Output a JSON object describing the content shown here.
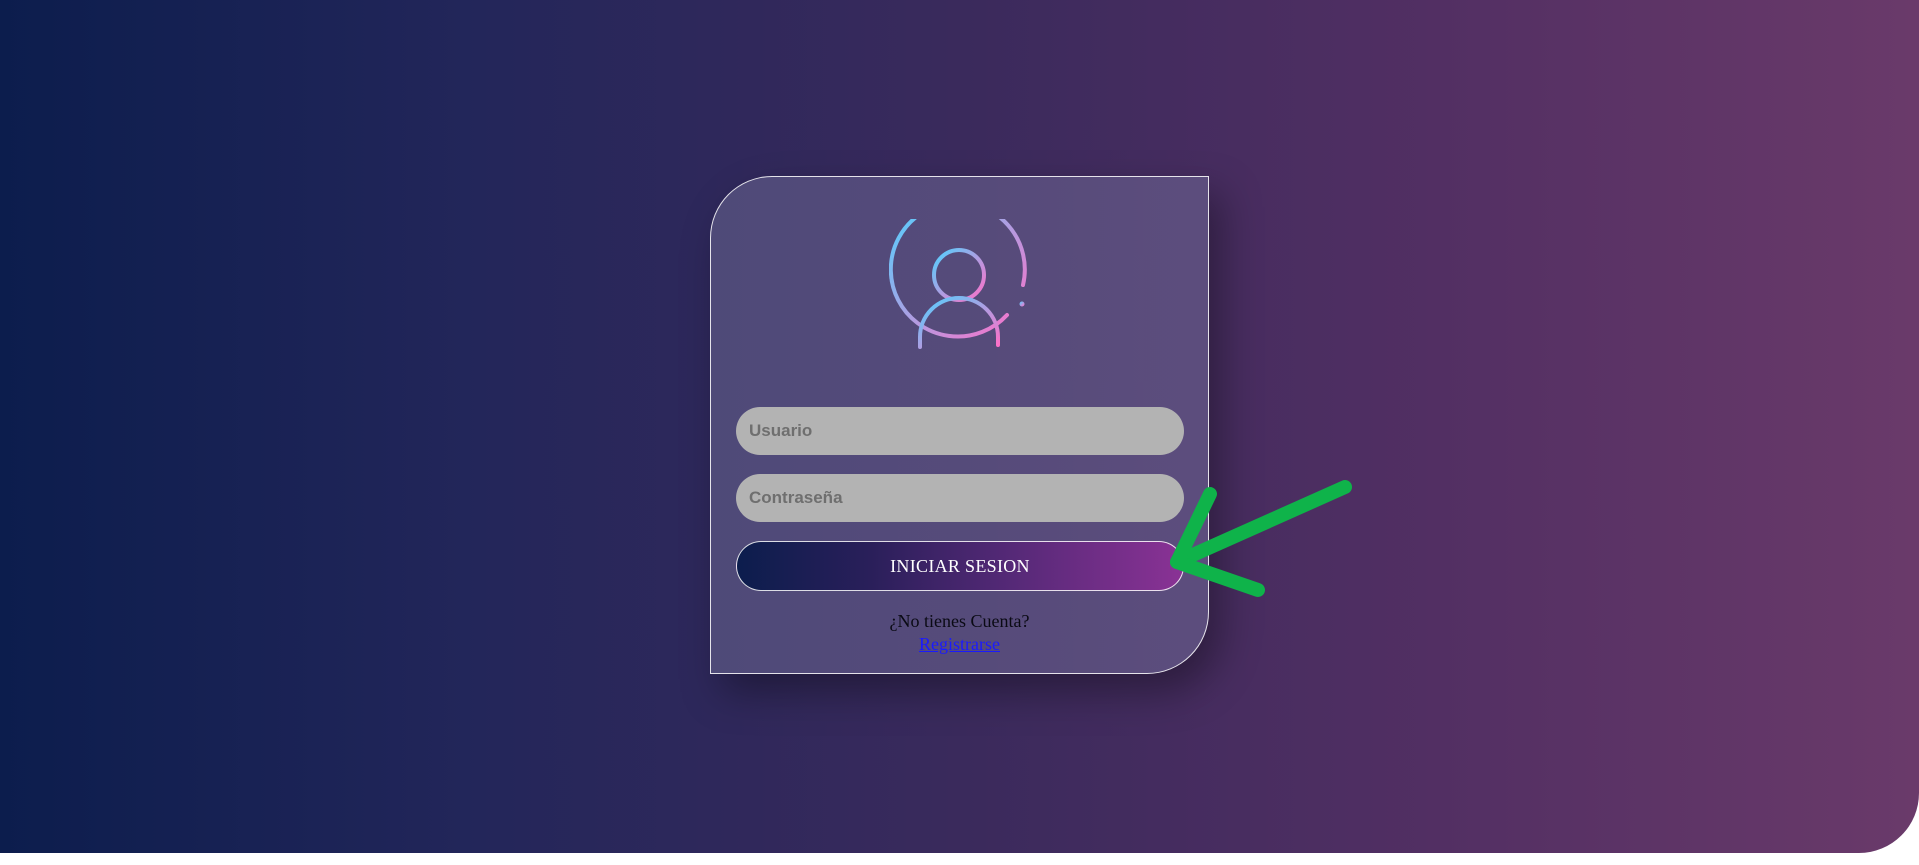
{
  "login": {
    "username_placeholder": "Usuario",
    "password_placeholder": "Contraseña",
    "submit_label": "INICIAR SESION",
    "no_account_text": "¿No tienes Cuenta?",
    "register_link": "Registrarse"
  },
  "icons": {
    "avatar": "user-circle-icon",
    "annotation": "green-arrow-icon"
  },
  "colors": {
    "background_start": "#0c1d4d",
    "background_end": "#6a3a6a",
    "input_bg": "#b3b3b3",
    "button_gradient_end": "#8a3295",
    "avatar_gradient_start": "#4fd2ff",
    "avatar_gradient_end": "#ff6ec7",
    "arrow": "#0fb34a",
    "link": "#1a1aff"
  }
}
